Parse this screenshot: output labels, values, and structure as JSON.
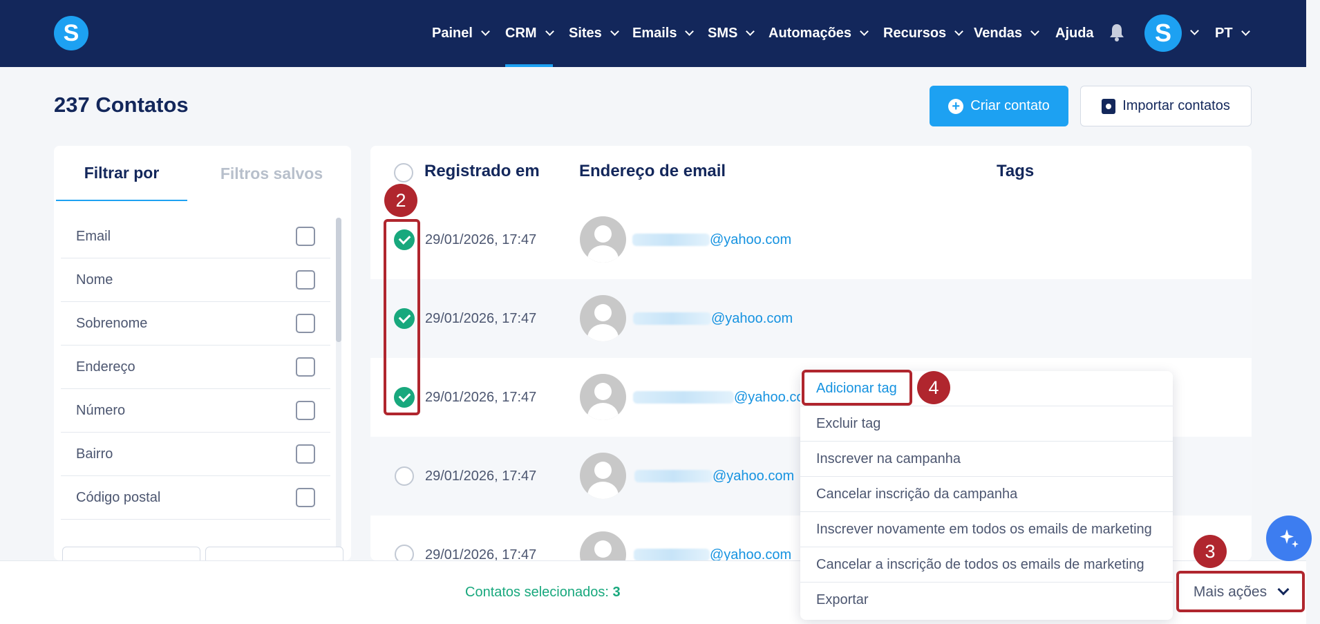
{
  "nav": {
    "items": [
      {
        "label": "Painel",
        "has_dropdown": true
      },
      {
        "label": "CRM",
        "has_dropdown": true,
        "active": true
      },
      {
        "label": "Sites",
        "has_dropdown": true
      },
      {
        "label": "Emails",
        "has_dropdown": true
      },
      {
        "label": "SMS",
        "has_dropdown": true
      },
      {
        "label": "Automações",
        "has_dropdown": true
      },
      {
        "label": "Recursos",
        "has_dropdown": true
      },
      {
        "label": "Vendas",
        "has_dropdown": true
      },
      {
        "label": "Ajuda",
        "has_dropdown": false
      }
    ],
    "logo_letter": "S",
    "avatar_letter": "S",
    "language": "PT"
  },
  "page": {
    "title": "237 Contatos",
    "create_button": "Criar contato",
    "import_button": "Importar contatos"
  },
  "filters": {
    "tab_active": "Filtrar por",
    "tab_inactive": "Filtros salvos",
    "items": [
      "Email",
      "Nome",
      "Sobrenome",
      "Endereço",
      "Número",
      "Bairro",
      "Código postal"
    ]
  },
  "table": {
    "headers": {
      "registered": "Registrado em",
      "email": "Endereço de email",
      "tags": "Tags"
    },
    "rows": [
      {
        "date": "29/01/2026, 17:47",
        "email_domain": "@yahoo.com",
        "selected": true
      },
      {
        "date": "29/01/2026, 17:47",
        "email_domain": "@yahoo.com",
        "selected": true
      },
      {
        "date": "29/01/2026, 17:47",
        "email_domain": "@yahoo.co",
        "selected": true
      },
      {
        "date": "29/01/2026, 17:47",
        "email_domain": "@yahoo.com",
        "selected": false
      },
      {
        "date": "29/01/2026, 17:47",
        "email_domain": "@yahoo.com",
        "selected": false
      }
    ]
  },
  "bottom": {
    "selected_label": "Contatos selecionados:",
    "selected_count": "3",
    "more_actions": "Mais ações"
  },
  "dropdown": {
    "items": [
      "Adicionar tag",
      "Excluir tag",
      "Inscrever na campanha",
      "Cancelar inscrição da campanha",
      "Inscrever novamente em todos os emails de marketing",
      "Cancelar a inscrição de todos os emails de marketing",
      "Exportar"
    ]
  },
  "annotations": {
    "two": "2",
    "three": "3",
    "four": "4"
  },
  "colors": {
    "nav_bg": "#13275b",
    "accent": "#1da1f2",
    "selected": "#18a87d",
    "annotation": "#b0262e"
  }
}
